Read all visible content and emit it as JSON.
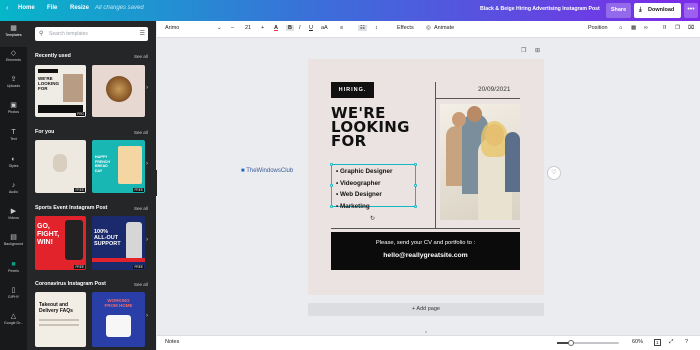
{
  "topbar": {
    "home": "Home",
    "file": "File",
    "resize": "Resize",
    "saved_status": "All changes saved",
    "doc_title": "Black & Beige Hiring Advertising Instagram Post",
    "share": "Share",
    "download": "Download",
    "more": "•••"
  },
  "rail": {
    "items": [
      {
        "label": "Templates",
        "icon": "templates-icon"
      },
      {
        "label": "Elements",
        "icon": "elements-icon"
      },
      {
        "label": "Uploads",
        "icon": "uploads-icon"
      },
      {
        "label": "Photos",
        "icon": "photos-icon"
      },
      {
        "label": "Text",
        "icon": "text-icon"
      },
      {
        "label": "Styles",
        "icon": "styles-icon"
      },
      {
        "label": "Audio",
        "icon": "audio-icon"
      },
      {
        "label": "Videos",
        "icon": "videos-icon"
      },
      {
        "label": "Background",
        "icon": "background-icon"
      },
      {
        "label": "Pexels",
        "icon": "pexels-icon"
      },
      {
        "label": "GIPHY",
        "icon": "giphy-icon"
      },
      {
        "label": "Google Dr...",
        "icon": "google-drive-icon"
      }
    ]
  },
  "panel": {
    "search_placeholder": "Search templates",
    "see_all": "See all",
    "sections": [
      {
        "title": "Recently used"
      },
      {
        "title": "For you"
      },
      {
        "title": "Sports Event Instagram Post"
      },
      {
        "title": "Coronavirus Instagram Post"
      }
    ],
    "thumbs": {
      "recent1": "WE'RE LOOKING FOR",
      "foryou2": "HAPPY FRENCH BREAD DAY",
      "sport1_a": "GO,",
      "sport1_b": "FIGHT,",
      "sport1_c": "WIN!",
      "sport2_a": "100%",
      "sport2_b": "ALL-OUT",
      "sport2_c": "SUPPORT",
      "covid1_a": "Takeout and",
      "covid1_b": "Delivery FAQs",
      "covid2_a": "WORKING",
      "covid2_b": "FROM HOME",
      "badge_free": "FREE",
      "badge_pro": "PRO"
    }
  },
  "toolbar": {
    "font": "Arimo",
    "minus": "–",
    "font_size": "21",
    "plus": "+",
    "effects": "Effects",
    "animate": "Animate",
    "position": "Position"
  },
  "design": {
    "tag": "HIRING.",
    "date": "20/09/2021",
    "headline_1": "WE'RE",
    "headline_2": "LOOKING",
    "headline_3": "FOR",
    "list": [
      "Graphic Designer",
      "Videographer",
      "Web Designer",
      "Marketing"
    ],
    "cta_line": "Please, send your CV and portfolio to :",
    "cta_email": "hello@reallygreatsite.com"
  },
  "canvas": {
    "add_page": "+ Add page",
    "watermark": "TheWindowsClub"
  },
  "bottombar": {
    "notes": "Notes",
    "zoom": "60%",
    "page_count": "1",
    "zoom_fraction": 0.22
  }
}
